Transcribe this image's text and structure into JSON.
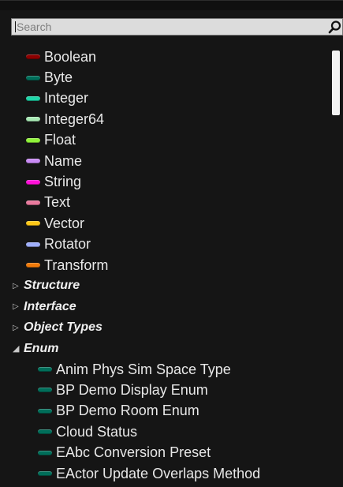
{
  "search": {
    "placeholder": "Search",
    "value": ""
  },
  "types": [
    {
      "label": "Boolean",
      "color": "#8c0000"
    },
    {
      "label": "Byte",
      "color": "#006e5a"
    },
    {
      "label": "Integer",
      "color": "#1ed6a8"
    },
    {
      "label": "Integer64",
      "color": "#a8e8b4"
    },
    {
      "label": "Float",
      "color": "#90f23a"
    },
    {
      "label": "Name",
      "color": "#c98bf5"
    },
    {
      "label": "String",
      "color": "#ff10d8"
    },
    {
      "label": "Text",
      "color": "#e9799d"
    },
    {
      "label": "Vector",
      "color": "#fcc717"
    },
    {
      "label": "Rotator",
      "color": "#9eaefb"
    },
    {
      "label": "Transform",
      "color": "#f07a0a"
    }
  ],
  "categories": [
    {
      "label": "Structure",
      "expanded": false,
      "arrow": "▷"
    },
    {
      "label": "Interface",
      "expanded": false,
      "arrow": "▷"
    },
    {
      "label": "Object Types",
      "expanded": false,
      "arrow": "▷"
    },
    {
      "label": "Enum",
      "expanded": true,
      "arrow": "◢"
    }
  ],
  "enum_items": [
    {
      "label": "Anim Phys Sim Space Type",
      "color": "#006e5a"
    },
    {
      "label": "BP Demo Display Enum",
      "color": "#006e5a"
    },
    {
      "label": "BP Demo Room Enum",
      "color": "#006e5a"
    },
    {
      "label": "Cloud Status",
      "color": "#006e5a"
    },
    {
      "label": "EAbc Conversion Preset",
      "color": "#006e5a"
    },
    {
      "label": "EActor Update Overlaps Method",
      "color": "#006e5a"
    }
  ]
}
